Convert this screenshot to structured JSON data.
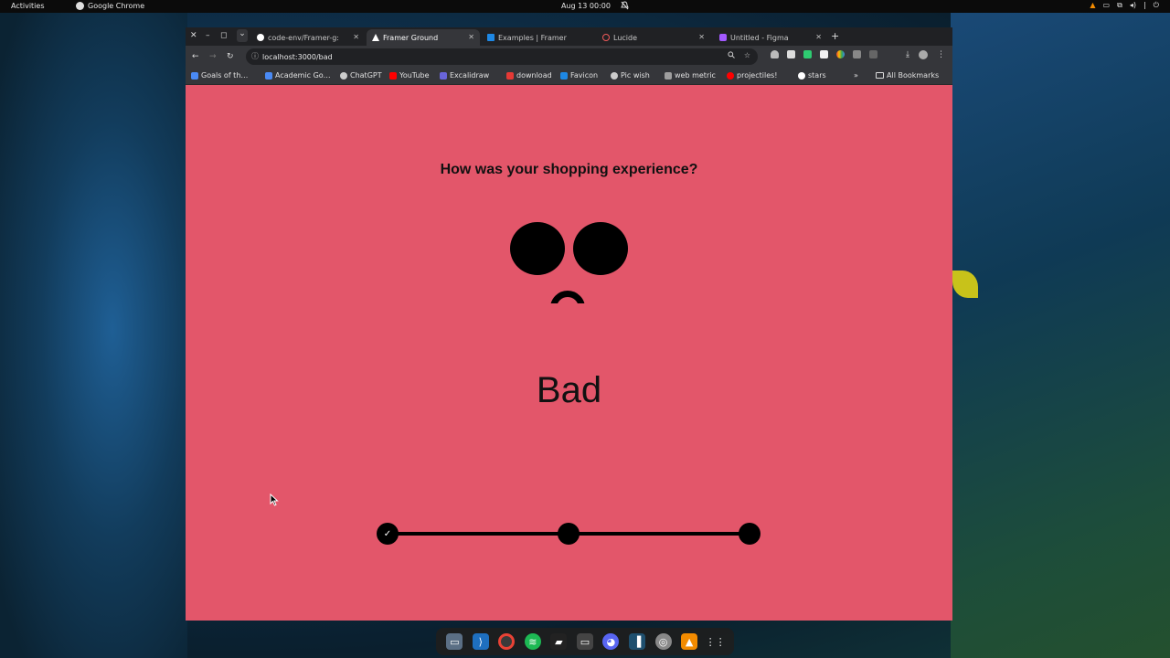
{
  "topbar": {
    "activities": "Activities",
    "app_name": "Google Chrome",
    "clock": "Aug 13  00:00"
  },
  "tabs": [
    {
      "label": "code-env/Framer-g:",
      "icon_color": "#ffffff"
    },
    {
      "label": "Framer Ground",
      "icon_color": "#ffffff"
    },
    {
      "label": "Examples | Framer",
      "icon_color": "#1e88e5"
    },
    {
      "label": "Lucide",
      "icon_color": "#f05a5a"
    },
    {
      "label": "Untitled - Figma",
      "icon_color": "#a259ff"
    }
  ],
  "address": {
    "url": "localhost:3000/bad"
  },
  "bookmarks": [
    {
      "label": "Goals of th…",
      "color": "#4a8af4"
    },
    {
      "label": "Academic Go…",
      "color": "#4a8af4"
    },
    {
      "label": "ChatGPT",
      "color": "#cccccc"
    },
    {
      "label": "YouTube",
      "color": "#ff0000"
    },
    {
      "label": "Excalidraw",
      "color": "#6965db"
    },
    {
      "label": "download",
      "color": "#e53935"
    },
    {
      "label": "Favicon",
      "color": "#1e88e5"
    },
    {
      "label": "Pic wish",
      "color": "#cccccc"
    },
    {
      "label": "web metric",
      "color": "#9e9e9e"
    },
    {
      "label": "projectiles!",
      "color": "#ff0000"
    },
    {
      "label": "stars",
      "color": "#ffffff"
    }
  ],
  "bookmarks_more": "»",
  "all_bookmarks": "All Bookmarks",
  "page": {
    "question": "How was your shopping experience?",
    "rating_label": "Bad",
    "background": "#e3566a",
    "slider": {
      "steps": 3,
      "selected_index": 0,
      "check_glyph": "✓"
    }
  },
  "icons": {
    "close": "✕",
    "minimize": "–",
    "maximize": "◻",
    "chevron": "⌄",
    "back": "←",
    "forward": "→",
    "reload": "↻",
    "new_tab": "+",
    "info": "ⓘ",
    "zoom": "🔍",
    "star": "☆",
    "download": "⤓",
    "menu": "⋮",
    "bell": "🔕"
  }
}
